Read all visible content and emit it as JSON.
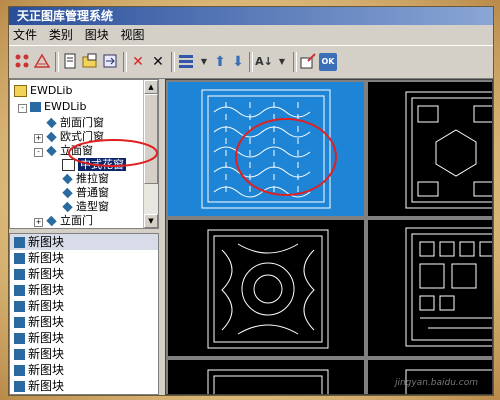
{
  "window": {
    "title": "天正图库管理系统"
  },
  "menu": [
    "文件",
    "类别",
    "图块",
    "视图"
  ],
  "toolbar": {
    "icons": [
      "layout-icon",
      "triangle-icon",
      "page-icon",
      "folder-open-icon",
      "swap-icon",
      "delete-red-icon",
      "delete-black-icon",
      "grid-icon",
      "arrow-up-icon",
      "arrow-down-icon",
      "sort-icon",
      "dropdown-icon",
      "insert-icon",
      "ok-icon"
    ],
    "ok_label": "OK"
  },
  "tree": {
    "root": "EWDLib",
    "child": "EWDLib",
    "items": [
      {
        "label": "剖面门窗",
        "expander": ""
      },
      {
        "label": "欧式门窗",
        "expander": "+"
      },
      {
        "label": "立面窗",
        "expander": "-"
      },
      {
        "label": "中式花窗",
        "expander": "",
        "selected": true
      },
      {
        "label": "推拉窗",
        "expander": ""
      },
      {
        "label": "普通窗",
        "expander": ""
      },
      {
        "label": "造型窗",
        "expander": ""
      },
      {
        "label": "立面门",
        "expander": "+"
      }
    ]
  },
  "blocks": [
    "新图块",
    "新图块",
    "新图块",
    "新图块",
    "新图块",
    "新图块",
    "新图块",
    "新图块",
    "新图块",
    "新图块"
  ],
  "annotation": {
    "color": "#e02020",
    "description": "red-highlight-circle"
  },
  "watermark": "jingyan.baidu.com"
}
